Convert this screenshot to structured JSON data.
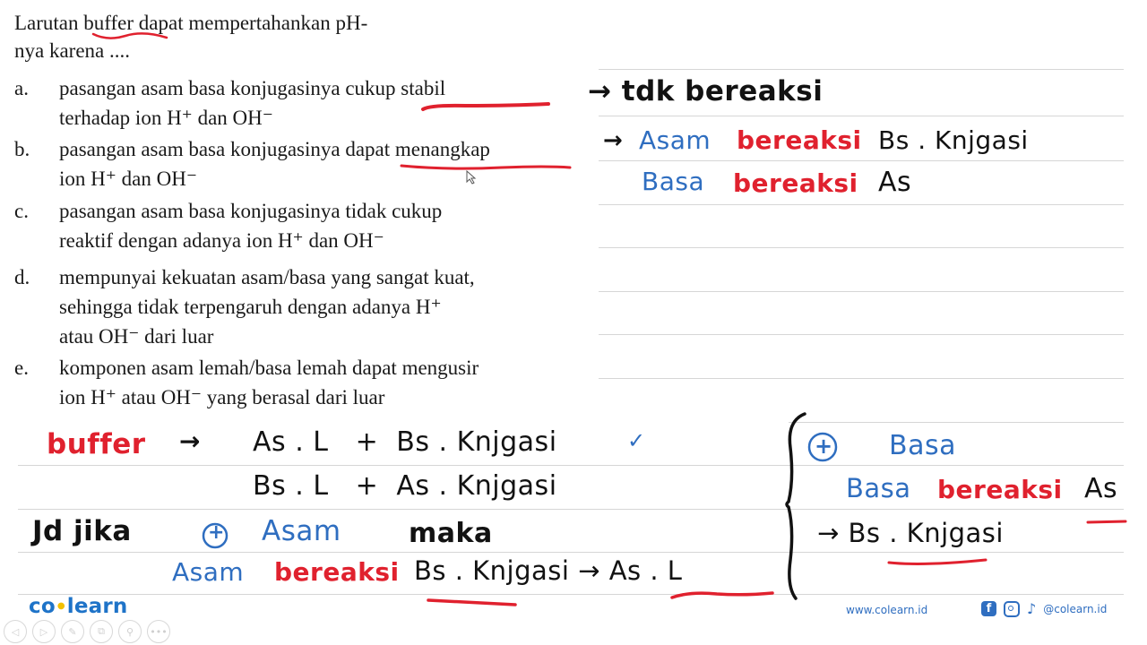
{
  "question": {
    "stem_line1": "Larutan buffer dapat mempertahankan pH-",
    "stem_line2": "nya karena ....",
    "options": [
      {
        "letter": "a.",
        "line1": "pasangan asam basa konjugasinya cukup stabil",
        "line2": "terhadap ion H⁺ dan OH⁻"
      },
      {
        "letter": "b.",
        "line1": "pasangan asam basa konjugasinya dapat menangkap",
        "line2": "ion H⁺ dan OH⁻"
      },
      {
        "letter": "c.",
        "line1": "pasangan asam basa konjugasinya tidak cukup",
        "line2": "reaktif dengan adanya ion H⁺ dan OH⁻"
      },
      {
        "letter": "d.",
        "line1": "mempunyai kekuatan asam/basa yang sangat kuat,",
        "line2": "sehingga tidak terpengaruh dengan adanya H⁺",
        "line3": "atau OH⁻ dari luar"
      },
      {
        "letter": "e.",
        "line1": "komponen asam lemah/basa lemah dapat mengusir",
        "line2": "ion H⁺ atau OH⁻ yang berasal dari luar"
      }
    ]
  },
  "notes_right": {
    "a_note": "→ tdk bereaksi",
    "b_note1_arrow": "→",
    "b_note1_acid": "Asam",
    "b_note1_verb": "bereaksi",
    "b_note1_target": "Bs . Knjgasi",
    "b_note2_base": "Basa",
    "b_note2_verb": "bereaksi",
    "b_note2_target": "As"
  },
  "notes_bottom": {
    "buffer_label": "buffer",
    "arrow": "→",
    "pair1": "As . L   +  Bs . Knjgasi",
    "check": "✓",
    "pair2": "Bs . L   +  As . Knjgasi",
    "jd_jika": "Jd jika",
    "plus_circle": "+",
    "added_acid": "Asam",
    "maka": "maka",
    "acid_subject": "Asam",
    "acid_verb": "bereaksi",
    "acid_target": "Bs . Knjgasi → As . L",
    "brace_plus": "+",
    "added_base": "Basa",
    "base_subject": "Basa",
    "base_verb": "bereaksi",
    "base_target": "As",
    "base_result": "→ Bs . Knjgasi"
  },
  "footer": {
    "logo_left": "co",
    "logo_dot": "●",
    "logo_right": "learn",
    "controls": [
      "◁",
      "▷",
      "✎",
      "⧉",
      "⚲",
      "•••"
    ],
    "website": "www.colearn.id",
    "facebook": "f",
    "tiktok": "♪",
    "handle": "@colearn.id"
  },
  "colors": {
    "annotation_red": "#e0212e",
    "annotation_blue": "#2f6ec0",
    "brand_blue": "#1e73c8",
    "rule_gray": "#d6d6d6"
  }
}
